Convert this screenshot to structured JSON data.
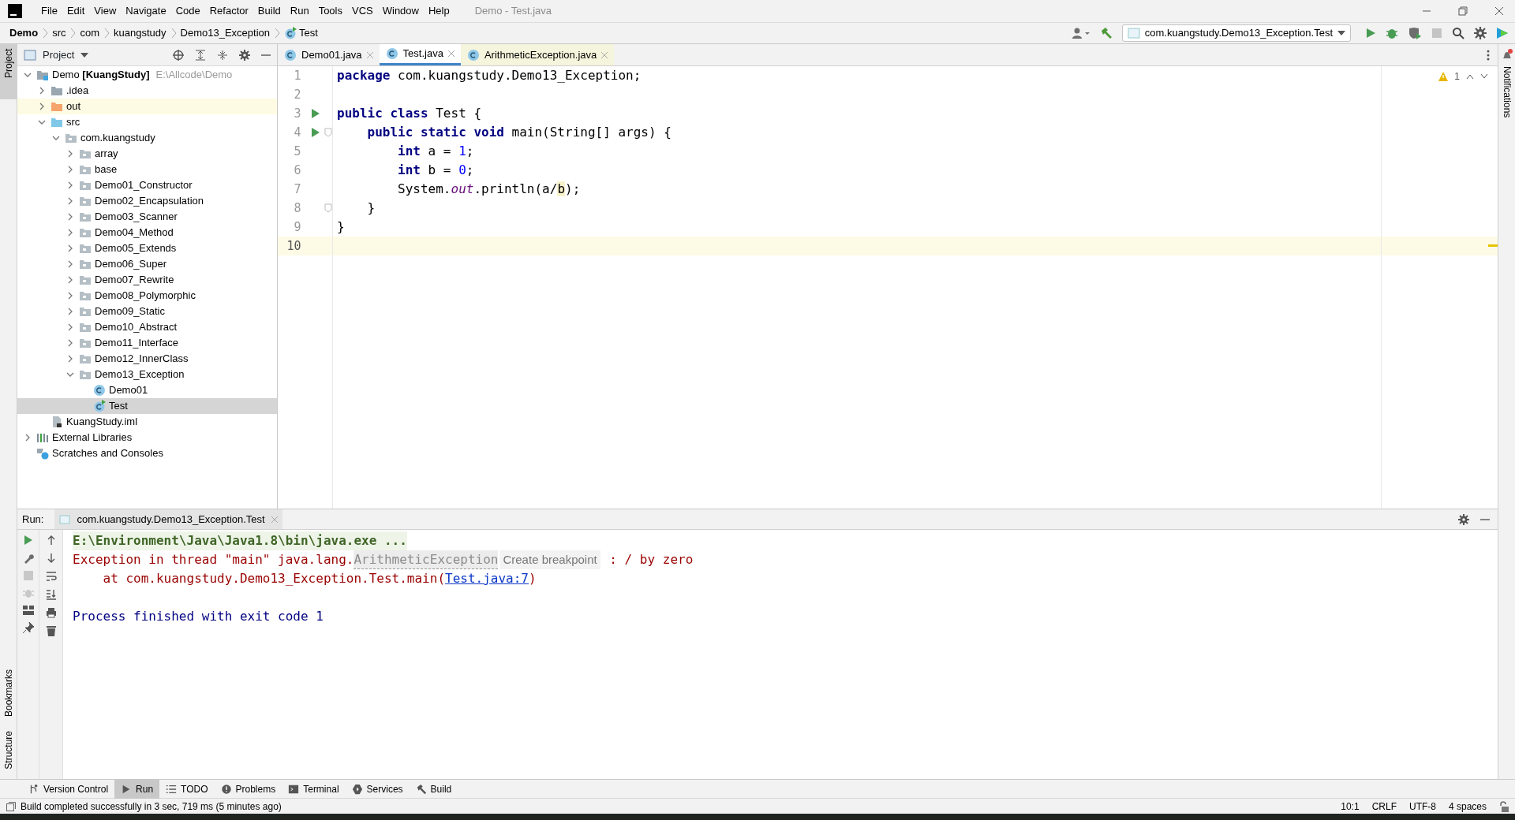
{
  "window": {
    "title": "Demo - Test.java"
  },
  "menu": [
    "File",
    "Edit",
    "View",
    "Navigate",
    "Code",
    "Refactor",
    "Build",
    "Run",
    "Tools",
    "VCS",
    "Window",
    "Help"
  ],
  "breadcrumbs": [
    {
      "label": "Demo",
      "bold": true,
      "kind": "plain"
    },
    {
      "label": "src",
      "bold": false,
      "kind": "plain"
    },
    {
      "label": "com",
      "bold": false,
      "kind": "plain"
    },
    {
      "label": "kuangstudy",
      "bold": false,
      "kind": "plain"
    },
    {
      "label": "Demo13_Exception",
      "bold": false,
      "kind": "plain"
    },
    {
      "label": "Test",
      "bold": false,
      "kind": "class-run"
    }
  ],
  "run_config": "com.kuangstudy.Demo13_Exception.Test",
  "project": {
    "title": "Project",
    "tree": [
      {
        "label": "Demo **[KuangStudy]**",
        "hint": "E:\\Allcode\\Demo",
        "kind": "module",
        "expanded": true,
        "selected": false,
        "highlighted": false,
        "children": [
          {
            "label": ".idea",
            "kind": "folder",
            "expanded": false,
            "selected": false,
            "highlighted": false
          },
          {
            "label": "out",
            "kind": "folder-excluded",
            "expanded": false,
            "selected": false,
            "highlighted": true
          },
          {
            "label": "src",
            "kind": "folder-source",
            "expanded": true,
            "selected": false,
            "highlighted": false,
            "children": [
              {
                "label": "com.kuangstudy",
                "kind": "package",
                "expanded": true,
                "selected": false,
                "highlighted": false,
                "children": [
                  {
                    "label": "array",
                    "kind": "package",
                    "expanded": false,
                    "selected": false,
                    "highlighted": false
                  },
                  {
                    "label": "base",
                    "kind": "package",
                    "expanded": false,
                    "selected": false,
                    "highlighted": false
                  },
                  {
                    "label": "Demo01_Constructor",
                    "kind": "package",
                    "expanded": false,
                    "selected": false,
                    "highlighted": false
                  },
                  {
                    "label": "Demo02_Encapsulation",
                    "kind": "package",
                    "expanded": false,
                    "selected": false,
                    "highlighted": false
                  },
                  {
                    "label": "Demo03_Scanner",
                    "kind": "package",
                    "expanded": false,
                    "selected": false,
                    "highlighted": false
                  },
                  {
                    "label": "Demo04_Method",
                    "kind": "package",
                    "expanded": false,
                    "selected": false,
                    "highlighted": false
                  },
                  {
                    "label": "Demo05_Extends",
                    "kind": "package",
                    "expanded": false,
                    "selected": false,
                    "highlighted": false
                  },
                  {
                    "label": "Demo06_Super",
                    "kind": "package",
                    "expanded": false,
                    "selected": false,
                    "highlighted": false
                  },
                  {
                    "label": "Demo07_Rewrite",
                    "kind": "package",
                    "expanded": false,
                    "selected": false,
                    "highlighted": false
                  },
                  {
                    "label": "Demo08_Polymorphic",
                    "kind": "package",
                    "expanded": false,
                    "selected": false,
                    "highlighted": false
                  },
                  {
                    "label": "Demo09_Static",
                    "kind": "package",
                    "expanded": false,
                    "selected": false,
                    "highlighted": false
                  },
                  {
                    "label": "Demo10_Abstract",
                    "kind": "package",
                    "expanded": false,
                    "selected": false,
                    "highlighted": false
                  },
                  {
                    "label": "Demo11_Interface",
                    "kind": "package",
                    "expanded": false,
                    "selected": false,
                    "highlighted": false
                  },
                  {
                    "label": "Demo12_InnerClass",
                    "kind": "package",
                    "expanded": false,
                    "selected": false,
                    "highlighted": false
                  },
                  {
                    "label": "Demo13_Exception",
                    "kind": "package",
                    "expanded": true,
                    "selected": false,
                    "highlighted": false,
                    "children": [
                      {
                        "label": "Demo01",
                        "kind": "class",
                        "selected": false,
                        "highlighted": false
                      },
                      {
                        "label": "Test",
                        "kind": "class-run",
                        "selected": true,
                        "highlighted": false
                      }
                    ]
                  }
                ]
              }
            ]
          },
          {
            "label": "KuangStudy.iml",
            "kind": "iml",
            "selected": false,
            "highlighted": false
          }
        ]
      },
      {
        "label": "External Libraries",
        "kind": "libraries",
        "expanded": false,
        "selected": false,
        "highlighted": false
      },
      {
        "label": "Scratches and Consoles",
        "kind": "scratches",
        "selected": false,
        "highlighted": false
      }
    ]
  },
  "editor": {
    "tabs": [
      {
        "label": "Demo01.java",
        "selected": false,
        "kind": "project"
      },
      {
        "label": "Test.java",
        "selected": true,
        "kind": "project"
      },
      {
        "label": "ArithmeticException.java",
        "selected": false,
        "kind": "library"
      }
    ],
    "warnings": "1",
    "lines": [
      {
        "number": "1",
        "current": false,
        "run_marker": false,
        "fold_marker": false,
        "tokens": [
          {
            "text": "package ",
            "kind": "keyword"
          },
          {
            "text": "com.kuangstudy.Demo13_Exception;",
            "kind": "plain"
          }
        ]
      },
      {
        "number": "2",
        "current": false,
        "run_marker": false,
        "fold_marker": false
      },
      {
        "number": "3",
        "current": false,
        "run_marker": true,
        "fold_marker": false,
        "tokens": [
          {
            "text": "public class ",
            "kind": "keyword"
          },
          {
            "text": "Test {",
            "kind": "plain"
          }
        ]
      },
      {
        "number": "4",
        "current": false,
        "run_marker": true,
        "fold_marker": true,
        "tokens": [
          {
            "text": "    public static void ",
            "kind": "keyword"
          },
          {
            "text": "main(String[] args) {",
            "kind": "plain"
          }
        ]
      },
      {
        "number": "5",
        "current": false,
        "run_marker": false,
        "fold_marker": false,
        "tokens": [
          {
            "text": "        int ",
            "kind": "keyword"
          },
          {
            "text": "a = ",
            "kind": "plain"
          },
          {
            "text": "1",
            "kind": "number"
          },
          {
            "text": ";",
            "kind": "plain"
          }
        ]
      },
      {
        "number": "6",
        "current": false,
        "run_marker": false,
        "fold_marker": false,
        "tokens": [
          {
            "text": "        int ",
            "kind": "keyword"
          },
          {
            "text": "b = ",
            "kind": "plain"
          },
          {
            "text": "0",
            "kind": "number"
          },
          {
            "text": ";",
            "kind": "plain"
          }
        ]
      },
      {
        "number": "7",
        "current": false,
        "run_marker": false,
        "fold_marker": false,
        "tokens": [
          {
            "text": "        System.",
            "kind": "plain"
          },
          {
            "text": "out",
            "kind": "static"
          },
          {
            "text": ".println(a/",
            "kind": "plain"
          },
          {
            "text": "b",
            "kind": "warning"
          },
          {
            "text": ");",
            "kind": "plain"
          }
        ]
      },
      {
        "number": "8",
        "current": false,
        "run_marker": false,
        "fold_marker": true,
        "tokens": [
          {
            "text": "    }",
            "kind": "plain"
          }
        ]
      },
      {
        "number": "9",
        "current": false,
        "run_marker": false,
        "fold_marker": false,
        "tokens": [
          {
            "text": "}",
            "kind": "plain"
          }
        ]
      },
      {
        "number": "10",
        "current": true,
        "run_marker": false,
        "fold_marker": false
      }
    ]
  },
  "run": {
    "label": "Run:",
    "tab": "com.kuangstudy.Demo13_Exception.Test",
    "console": [
      {
        "kind": "text",
        "tokens": [
          {
            "text": "E:\\Environment\\Java\\Java1.8\\bin\\java.exe ...",
            "kind": "command"
          }
        ]
      },
      {
        "kind": "text",
        "tokens": [
          {
            "text": "Exception in thread \"main\" java.lang.",
            "kind": "error"
          },
          {
            "text": "ArithmeticException",
            "kind": "class-link"
          },
          {
            "text": "Create breakpoint",
            "kind": "hint"
          },
          {
            "text": " : / by zero",
            "kind": "error"
          }
        ]
      },
      {
        "kind": "text",
        "tokens": [
          {
            "text": "    at com.kuangstudy.Demo13_Exception.Test.main(",
            "kind": "error"
          },
          {
            "text": "Test.java:7",
            "kind": "link"
          },
          {
            "text": ")",
            "kind": "error"
          }
        ]
      },
      {
        "kind": "blank"
      },
      {
        "kind": "text",
        "tokens": [
          {
            "text": "Process finished with exit code 1",
            "kind": "system"
          }
        ]
      }
    ]
  },
  "side_strips": {
    "left_top": [
      {
        "label": "Project",
        "selected": true
      }
    ],
    "left_bottom": [
      {
        "label": "Bookmarks",
        "selected": false
      },
      {
        "label": "Structure",
        "selected": false
      }
    ],
    "right": [
      {
        "label": "Notifications",
        "selected": false
      }
    ]
  },
  "tool_tabs": [
    {
      "label": "Version Control",
      "selected": false
    },
    {
      "label": "Run",
      "selected": true
    },
    {
      "label": "TODO",
      "selected": false
    },
    {
      "label": "Problems",
      "selected": false
    },
    {
      "label": "Terminal",
      "selected": false
    },
    {
      "label": "Services",
      "selected": false
    },
    {
      "label": "Build",
      "selected": false
    }
  ],
  "status_bar": {
    "message": "Build completed successfully in 3 sec, 719 ms (5 minutes ago)",
    "items": [
      "10:1",
      "CRLF",
      "UTF-8",
      "4 spaces"
    ]
  }
}
